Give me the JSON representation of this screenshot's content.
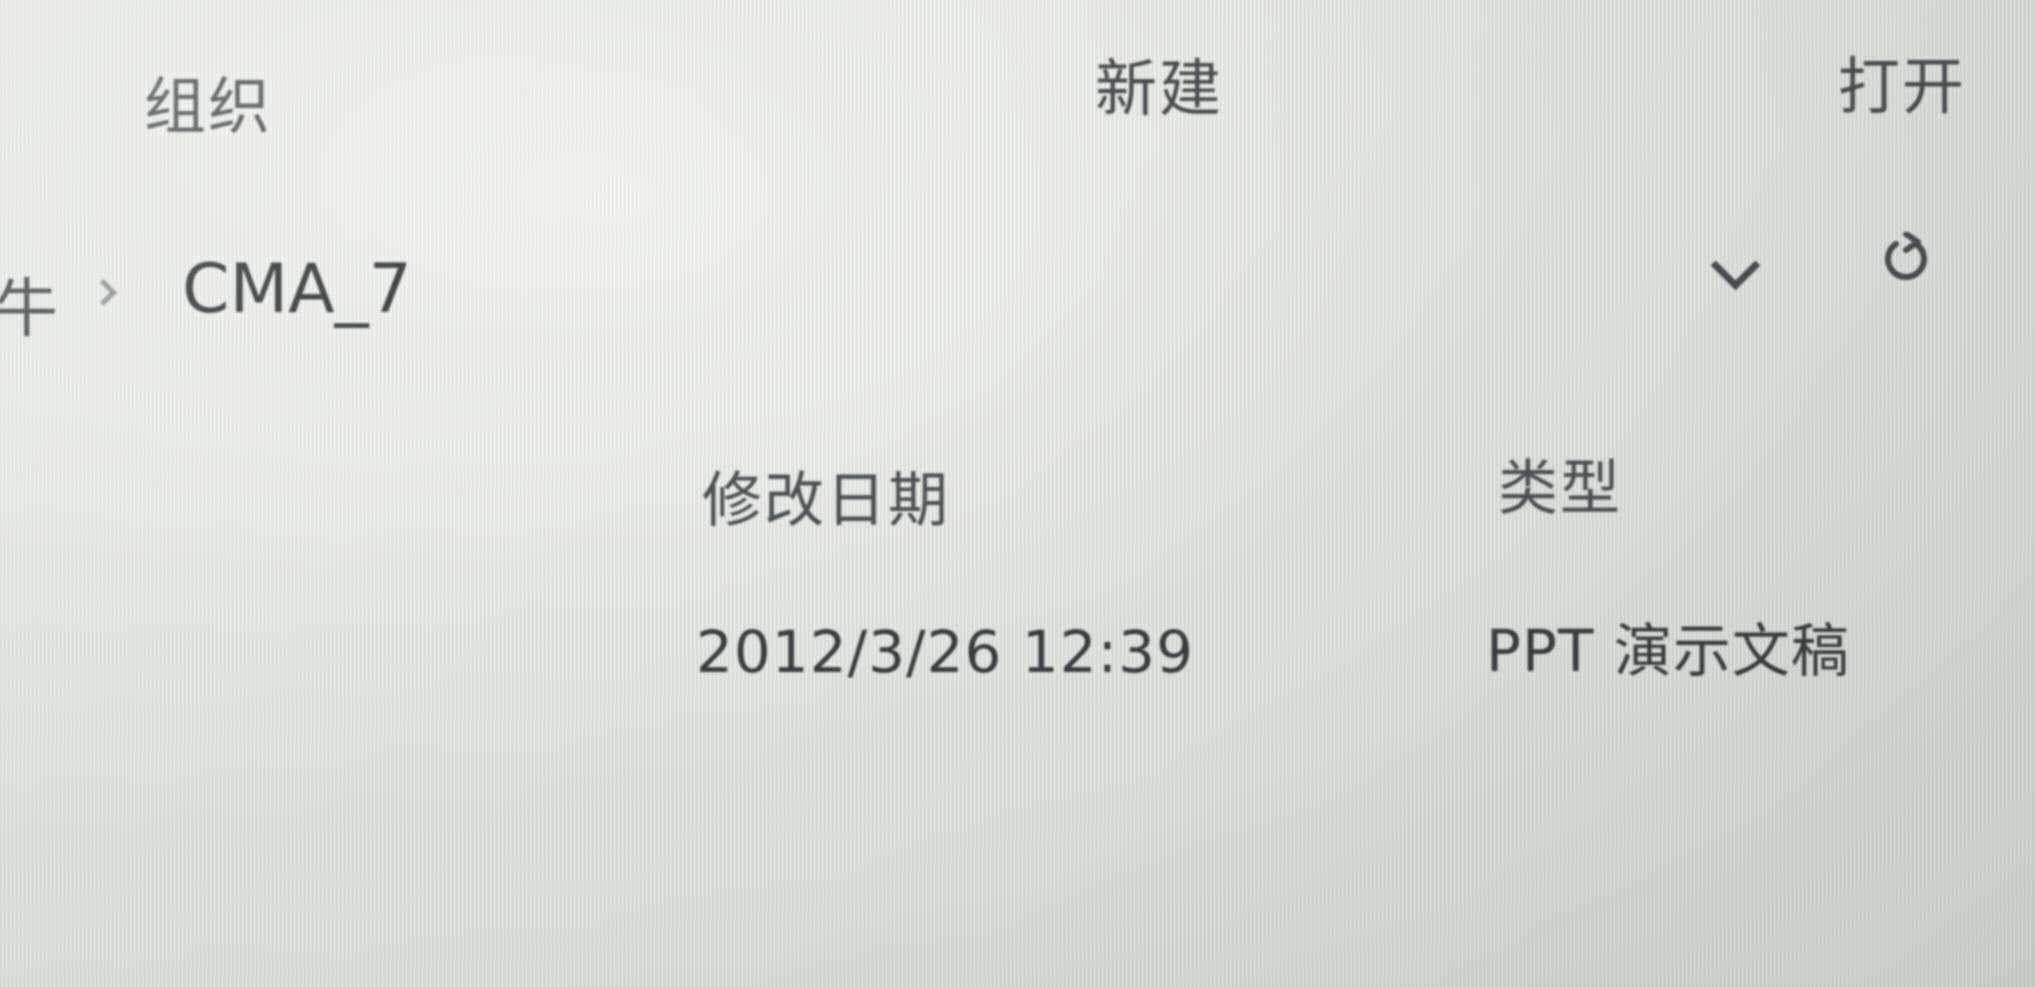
{
  "ribbon": {
    "organize": "组织",
    "new": "新建",
    "open": "打开"
  },
  "address_bar": {
    "partial_prev": "牛",
    "current": "CMA_7",
    "icons": [
      "chevron-down-icon",
      "refresh-icon"
    ]
  },
  "file_list": {
    "headers": [
      "修改日期",
      "类型"
    ],
    "rows": [
      {
        "modified": "2012/3/26 12:39",
        "type": "PPT 演示文稿"
      }
    ]
  }
}
